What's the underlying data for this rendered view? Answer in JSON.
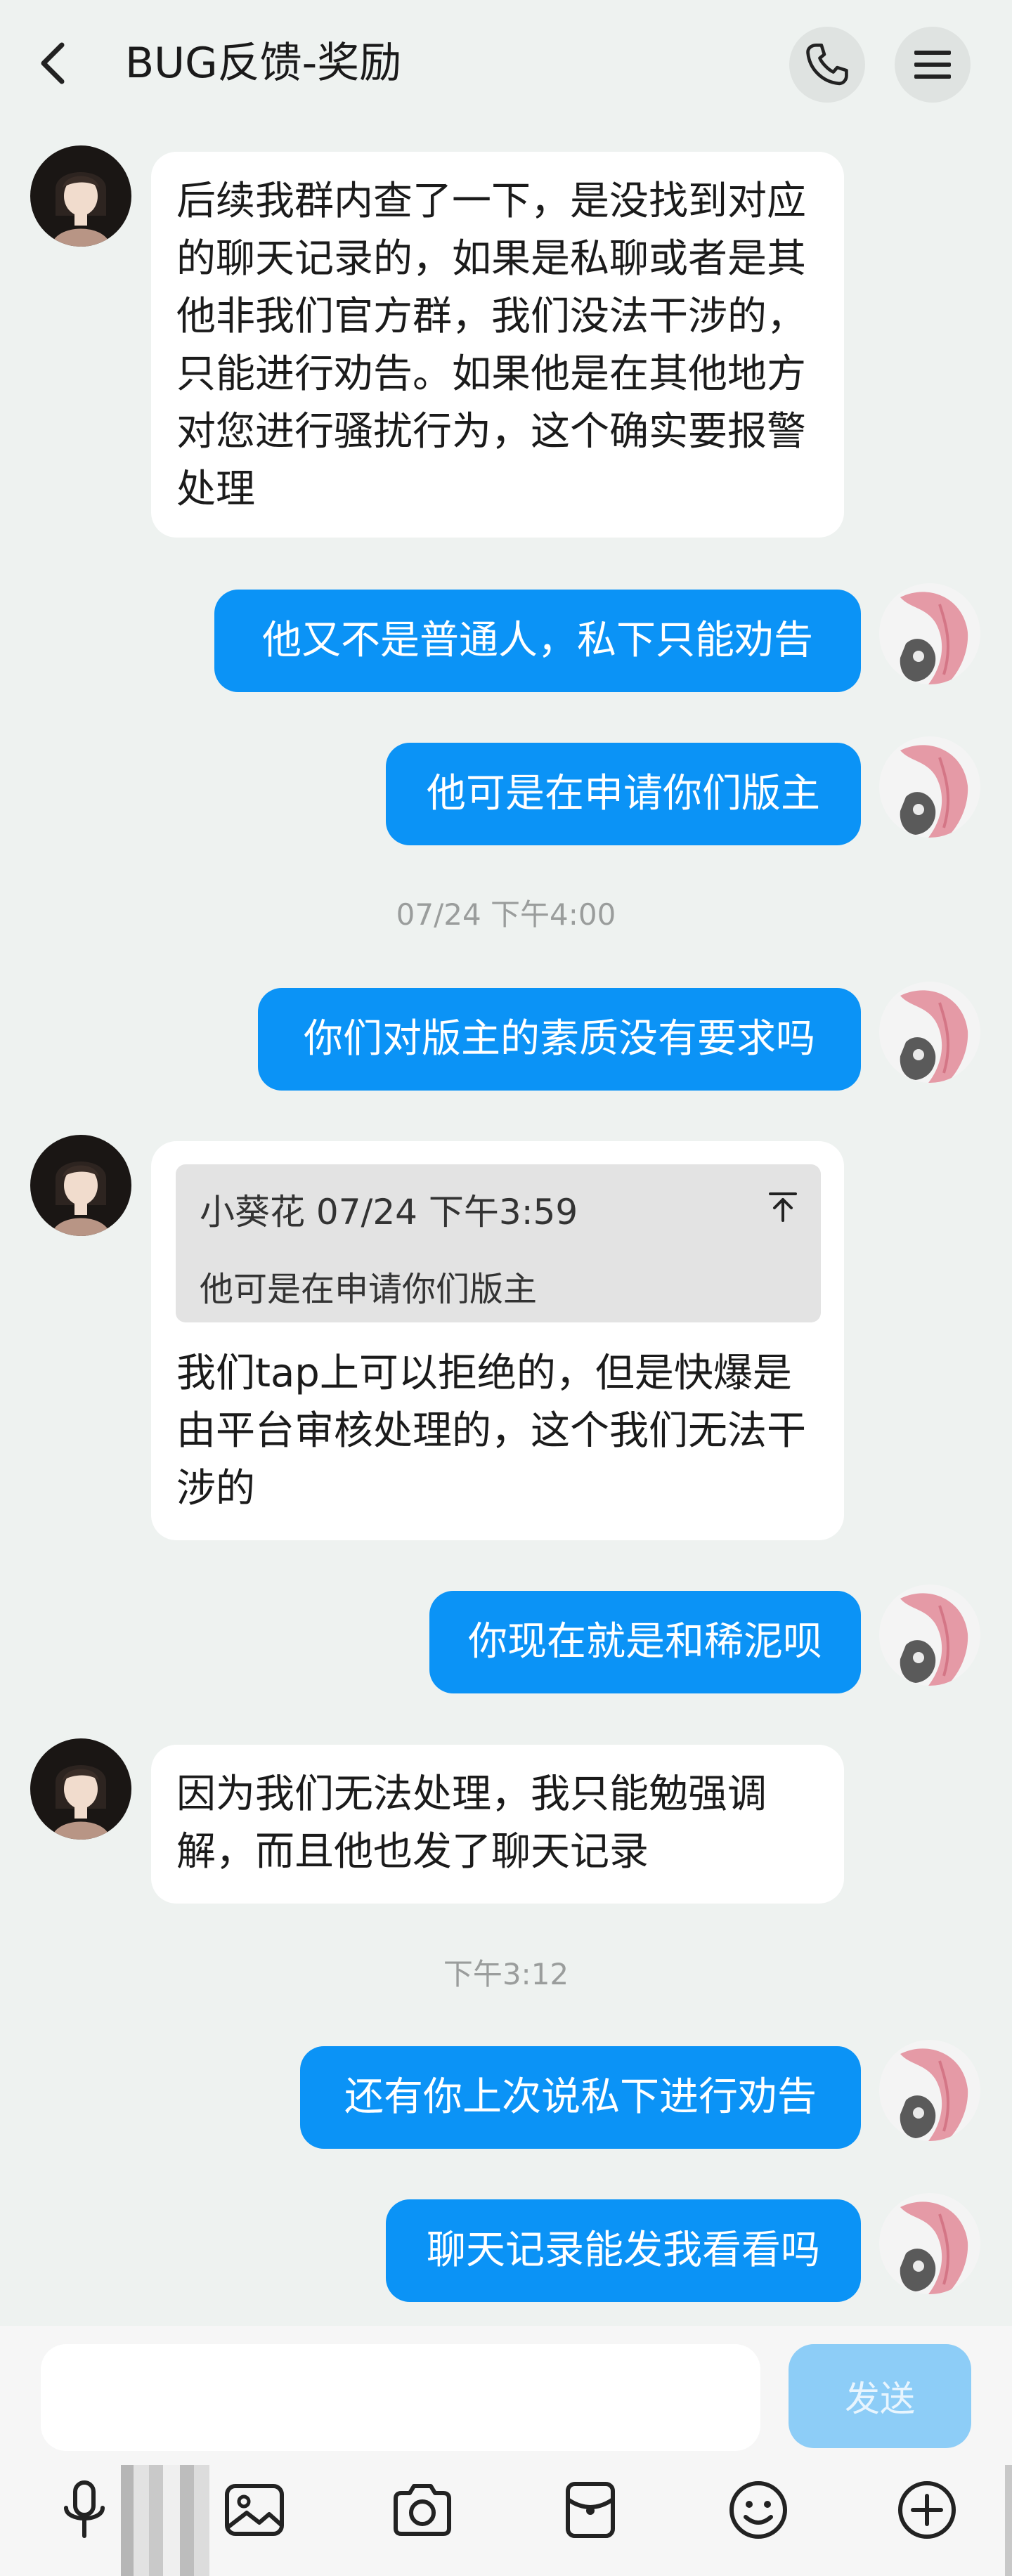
{
  "header": {
    "title": "BUG反馈-奖励",
    "icons": {
      "back": "chevron-left-icon",
      "call": "phone-icon",
      "menu": "hamburger-menu-icon"
    }
  },
  "messages": {
    "m1_text": "后续我群内查了一下，是没找到对应的聊天记录的，如果是私聊或者是其他非我们官方群，我们没法干涉的，只能进行劝告。如果他是在其他地方对您进行骚扰行为，这个确实要报警处理",
    "m2_text": "他又不是普通人，私下只能劝告",
    "m3_text": "他可是在申请你们版主",
    "ts1": "07/24 下午4:00",
    "m4_text": "你们对版主的素质没有要求吗",
    "m5_quote_header": "小葵花 07/24 下午3:59",
    "m5_quote_text": "他可是在申请你们版主",
    "m5_text": "我们tap上可以拒绝的，但是快爆是由平台审核处理的，这个我们无法干涉的",
    "m6_text": "你现在就是和稀泥呗",
    "m7_text": "因为我们无法处理，我只能勉强调解，而且他也发了聊天记录",
    "ts2": "下午3:12",
    "m8_text": "还有你上次说私下进行劝告",
    "m9_text": "聊天记录能发我看看吗"
  },
  "input_bar": {
    "value": "",
    "send_label": "发送"
  },
  "toolbar": {
    "icons": [
      "microphone-icon",
      "image-icon",
      "camera-icon",
      "red-packet-icon",
      "emoji-icon",
      "plus-icon"
    ]
  },
  "colors": {
    "accent": "#0b93f6",
    "send_disabled": "#8dcdf7",
    "background": "#eef2f0"
  }
}
